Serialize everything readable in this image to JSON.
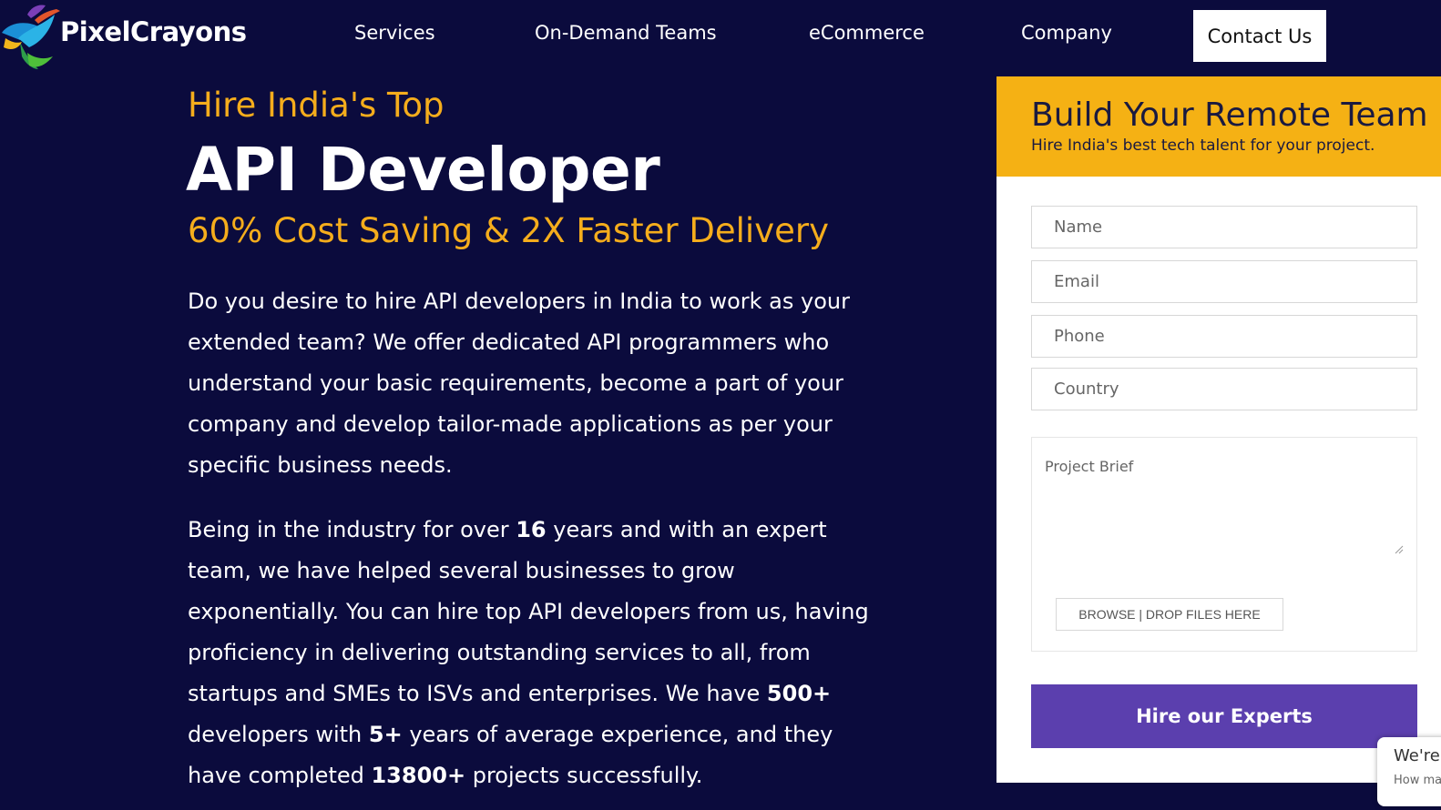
{
  "header": {
    "logo_text": "PixelCrayons",
    "nav": [
      "Services",
      "On-Demand Teams",
      "eCommerce",
      "Company"
    ],
    "contact_label": "Contact Us"
  },
  "hero": {
    "pretitle": "Hire India's Top",
    "title": "API Developer",
    "subtitle": "60% Cost Saving & 2X Faster Delivery",
    "para1": "Do you desire to hire API developers in India to work as your extended team? We offer dedicated API programmers who understand your basic requirements, become a part of your company and develop tailor-made applications as per your specific business needs.",
    "para2": {
      "t1": "Being in the industry for over ",
      "b1": "16",
      "t2": " years and with an expert team, we have helped several businesses to grow exponentially. You can hire top API developers from us, having proficiency in delivering outstanding services to all, from startups and SMEs to ISVs and enterprises. We have ",
      "b2": "500+",
      "t3": " developers with ",
      "b3": "5+",
      "t4": " years of average experience, and they have completed ",
      "b4": "13800+",
      "t5": " projects successfully."
    }
  },
  "form": {
    "title": "Build Your Remote Team",
    "subtitle": "Hire India's best tech talent for your project.",
    "name_placeholder": "Name",
    "email_placeholder": "Email",
    "phone_placeholder": "Phone",
    "country_placeholder": "Country",
    "brief_placeholder": "Project Brief",
    "browse_label": "BROWSE | DROP FILES HERE",
    "submit_label": "Hire our Experts"
  },
  "chat": {
    "title": "We're",
    "subtitle": "How ma"
  },
  "colors": {
    "background": "#0b0b3d",
    "accent": "#f5ad1c",
    "button": "#5b3fae"
  }
}
